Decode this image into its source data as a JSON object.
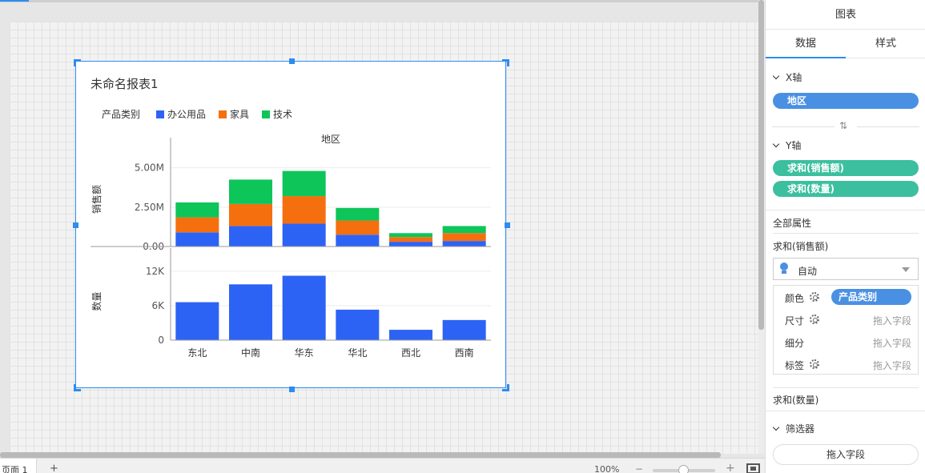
{
  "report": {
    "title": "未命名报表1",
    "legend_title": "产品类别"
  },
  "bottom_bar": {
    "page_tab": "页面 1",
    "add_page": "+",
    "zoom": "100%",
    "zoom_out": "−",
    "zoom_in": "+"
  },
  "panel": {
    "title": "图表",
    "tabs": [
      "数据",
      "样式"
    ],
    "x_axis": {
      "label": "X轴",
      "field": "地区"
    },
    "swap_icon": "⇅",
    "y_axis": {
      "label": "Y轴",
      "fields": [
        "求和(销售额)",
        "求和(数量)"
      ]
    },
    "all_props": "全部属性",
    "measure1": "求和(销售额)",
    "mark_type": "自动",
    "encodings": [
      {
        "label": "颜色",
        "field": "产品类别",
        "gear": true
      },
      {
        "label": "尺寸",
        "field": "拖入字段",
        "gear": true
      },
      {
        "label": "细分",
        "field": "拖入字段",
        "gear": false
      },
      {
        "label": "标签",
        "field": "拖入字段",
        "gear": true
      }
    ],
    "measure2": "求和(数量)",
    "filter_label": "筛选器",
    "filter_drop": "拖入字段"
  },
  "colors": {
    "office": "#2d63f5",
    "furniture": "#f56f0f",
    "tech": "#0ec55a",
    "accent": "#2d8cf0"
  },
  "chart_data": {
    "type": "bar",
    "title": "",
    "xlabel": "地区",
    "categories": [
      "东北",
      "中南",
      "华东",
      "华北",
      "西北",
      "西南"
    ],
    "legend": {
      "title": "产品类别",
      "position": "top-left"
    },
    "grid": true,
    "panels": [
      {
        "ylabel": "销售额",
        "stacked": true,
        "ylim": [
          0,
          6000000
        ],
        "ticks": [
          0,
          2500000,
          5000000
        ],
        "tick_labels": [
          "0.00",
          "2.50M",
          "5.00M"
        ],
        "series": [
          {
            "name": "办公用品",
            "color": "#2d63f5",
            "values": [
              900000,
              1300000,
              1450000,
              750000,
              300000,
              350000
            ]
          },
          {
            "name": "家具",
            "color": "#f56f0f",
            "values": [
              950000,
              1400000,
              1750000,
              900000,
              300000,
              500000
            ]
          },
          {
            "name": "技术",
            "color": "#0ec55a",
            "values": [
              950000,
              1550000,
              1600000,
              800000,
              250000,
              450000
            ]
          }
        ]
      },
      {
        "ylabel": "数量",
        "stacked": false,
        "ylim": [
          0,
          13500
        ],
        "ticks": [
          0,
          6000,
          12000
        ],
        "tick_labels": [
          "0",
          "6K",
          "12K"
        ],
        "series": [
          {
            "name": "办公用品",
            "color": "#2d63f5",
            "values": [
              6600,
              9700,
              11200,
              5300,
              1800,
              3500
            ]
          }
        ]
      }
    ]
  }
}
